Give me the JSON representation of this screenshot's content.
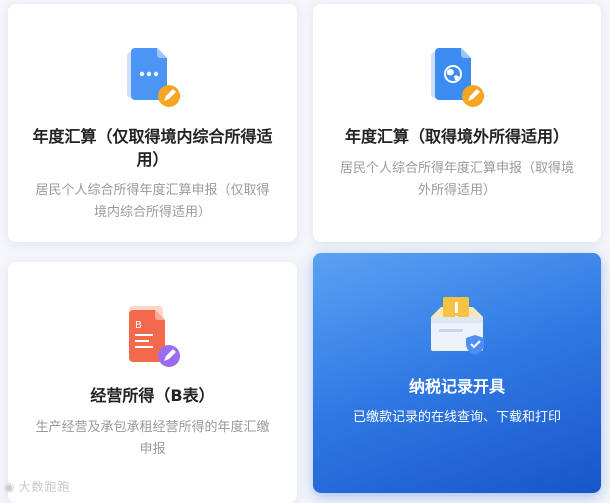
{
  "cards": [
    {
      "title": "年度汇算（仅取得境内综合所得适用）",
      "desc": "居民个人综合所得年度汇算申报（仅取得境内综合所得适用）",
      "icon": "document-dots-edit-icon"
    },
    {
      "title": "年度汇算（取得境外所得适用）",
      "desc": "居民个人综合所得年度汇算申报（取得境外所得适用）",
      "icon": "document-globe-edit-icon"
    },
    {
      "title": "经营所得（B表）",
      "desc": "生产经营及承包承租经营所得的年度汇缴申报",
      "icon": "document-b-edit-icon"
    },
    {
      "title": "纳税记录开具",
      "desc": "已缴款记录的在线查询、下载和打印",
      "icon": "tax-record-box-icon"
    }
  ],
  "watermark": "大数跑跑",
  "colors": {
    "accent_blue": "#2f78e3",
    "edit_orange": "#f5a524",
    "edit_purple": "#9b6bf0",
    "doc_red": "#f3694b"
  }
}
